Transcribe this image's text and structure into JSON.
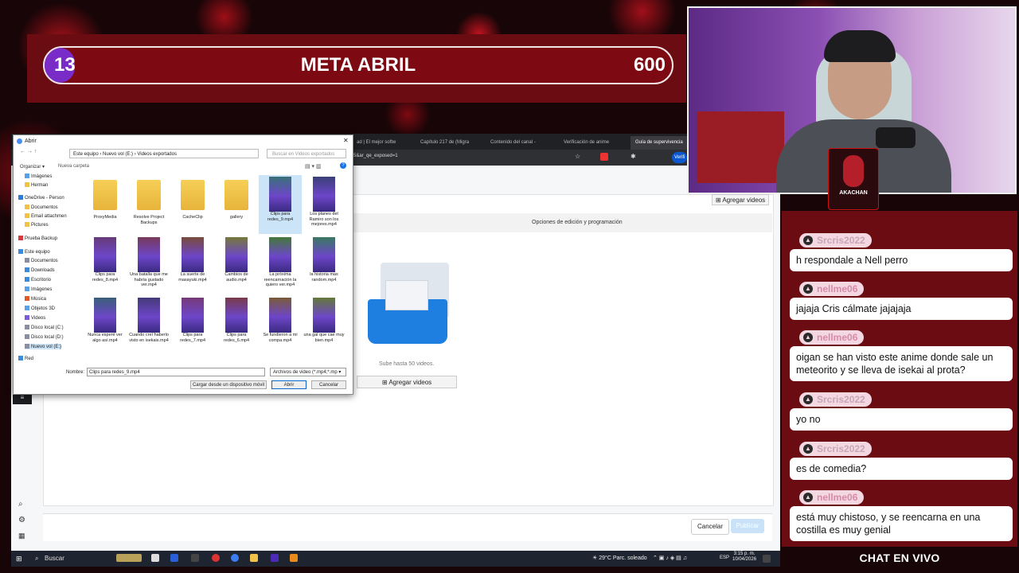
{
  "goal": {
    "current": "13",
    "title": "META ABRIL",
    "target": "600",
    "progress": 0.0217
  },
  "browser": {
    "tabs": [
      {
        "label": "ad | El mejor softw",
        "active": false
      },
      {
        "label": "Capítulo 217 de (Migra",
        "active": false
      },
      {
        "label": "Contenido del canal -",
        "active": false
      },
      {
        "label": "Verificación de anime",
        "active": false
      },
      {
        "label": "Guía de supervivencia",
        "active": true
      }
    ],
    "url_fragment": "5&ar_qe_exposed=1",
    "verify_label": "Verifi"
  },
  "upload_page": {
    "add_videos_top": "Agregar videos",
    "options_label": "Opciones de edición y programación",
    "upload_limit": "Sube hasta 50 videos.",
    "add_videos_main": "Agregar videos",
    "cancel": "Cancelar",
    "publish": "Publicar"
  },
  "dialog": {
    "title": "Abrir",
    "path": "Este equipo  ›  Nuevo vol (E:)  ›  Videos exportados",
    "search_placeholder": "Buscar en Videos exportados",
    "organize": "Organizar ▾",
    "new_folder": "Nueva carpeta",
    "tree": [
      {
        "label": "Imágenes",
        "color": "#5aa0e6"
      },
      {
        "label": "Herman",
        "color": "#f0c24a"
      },
      {
        "label": "OneDrive - Person",
        "color": "#2f7bd3"
      },
      {
        "label": "Documentos",
        "color": "#f0c24a"
      },
      {
        "label": "Email attachmen",
        "color": "#f0c24a"
      },
      {
        "label": "Pictures",
        "color": "#f0c24a"
      },
      {
        "label": "Prueba Backup",
        "color": "#d63b3b"
      },
      {
        "label": "Este equipo",
        "color": "#3c8ad8"
      },
      {
        "label": "Documentos",
        "color": "#8a8fa0"
      },
      {
        "label": "Downloads",
        "color": "#3c8ad8"
      },
      {
        "label": "Escritorio",
        "color": "#3c8ad8"
      },
      {
        "label": "Imágenes",
        "color": "#5aa0e6"
      },
      {
        "label": "Música",
        "color": "#e0592b"
      },
      {
        "label": "Objetos 3D",
        "color": "#5aa0e6"
      },
      {
        "label": "Videos",
        "color": "#7b5bd6"
      },
      {
        "label": "Disco local (C:)",
        "color": "#8a8fa0"
      },
      {
        "label": "Disco local (D:)",
        "color": "#8a8fa0"
      },
      {
        "label": "Nuevo vol (E:)",
        "color": "#8a8fa0"
      },
      {
        "label": "Red",
        "color": "#3c8ad8"
      }
    ],
    "files": [
      {
        "name": "ProxyMedia",
        "kind": "folder"
      },
      {
        "name": "Resolve Project Backups",
        "kind": "folder"
      },
      {
        "name": "CacheClip",
        "kind": "folder"
      },
      {
        "name": "gallery",
        "kind": "folder"
      },
      {
        "name": "Clips para redes_9.mp4",
        "kind": "video",
        "selected": true
      },
      {
        "name": "Los planes del Ramiro son los mejores.mp4",
        "kind": "video"
      },
      {
        "name": "Clips para redes_8.mp4",
        "kind": "video"
      },
      {
        "name": "Una batalla que me habría gustado ver.mp4",
        "kind": "video"
      },
      {
        "name": "La suerte de masayuki.mp4",
        "kind": "video"
      },
      {
        "name": "Cambios de audio.mp4",
        "kind": "video"
      },
      {
        "name": "La próxima reencarnación la quiero ver.mp4",
        "kind": "video"
      },
      {
        "name": "la historia mas random.mp4",
        "kind": "video"
      },
      {
        "name": "Nunca esperé ver algo así.mp4",
        "kind": "video"
      },
      {
        "name": "Cuando creí haberlo visto en isekais.mp4",
        "kind": "video"
      },
      {
        "name": "Clips para redes_7.mp4",
        "kind": "video"
      },
      {
        "name": "Clips para redes_6.mp4",
        "kind": "video"
      },
      {
        "name": "Se fundieron a mi compa.mp4",
        "kind": "video"
      },
      {
        "name": "una gal que cae muy bien.mp4",
        "kind": "video"
      }
    ],
    "name_label": "Nombre:",
    "name_value": "Clips para redes_9.mp4",
    "filter": "Archivos de video (*.mp4;*.mp",
    "mobile_button": "Cargar desde un dispositivo móvil",
    "open_button": "Abrir",
    "cancel_button": "Cancelar"
  },
  "stream_logo": "AKACHAN",
  "chat": {
    "title": "CHAT EN VIVO",
    "messages": [
      {
        "user": "Srcris2022",
        "text": "h respondale a Nell perro"
      },
      {
        "user": "nellme06",
        "text": "jajaja Cris cálmate jajajaja"
      },
      {
        "user": "nellme06",
        "text": "oigan se han visto este anime donde sale un meteorito y se lleva de isekai al prota?"
      },
      {
        "user": "Srcris2022",
        "text": "yo no"
      },
      {
        "user": "Srcris2022",
        "text": "es de comedia?"
      },
      {
        "user": "nellme06",
        "text": "está muy chistoso, y se reencarna en una costilla es muy genial"
      }
    ],
    "user_colors": {
      "Srcris2022": "#c8a6b6",
      "nellme06": "#d88aa8"
    }
  },
  "taskbar": {
    "search": "Buscar",
    "weather": "29°C  Parc. soleado",
    "lang": "ESP",
    "time": "3:15 p. m.",
    "date": "10/04/2026"
  }
}
